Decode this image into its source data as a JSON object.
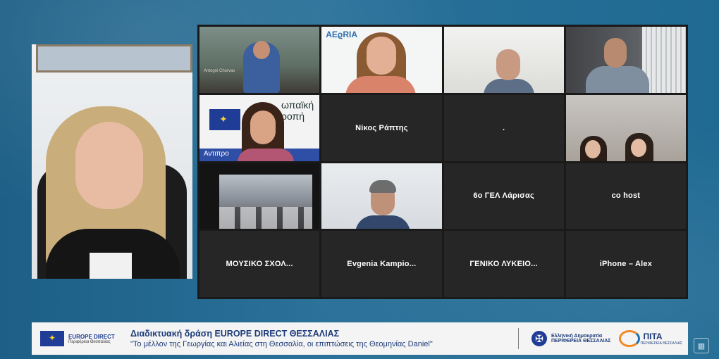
{
  "grid": {
    "tiles": [
      {
        "label": "",
        "video": "v1"
      },
      {
        "label": "",
        "video": "v2"
      },
      {
        "label": "",
        "video": "v3"
      },
      {
        "label": "",
        "video": "v4"
      },
      {
        "label": "",
        "video": "v5"
      },
      {
        "label": "Νίκος Ράπτης",
        "video": ""
      },
      {
        "label": ".",
        "video": ""
      },
      {
        "label": "",
        "video": "v6"
      },
      {
        "label": "",
        "video": "v7"
      },
      {
        "label": "",
        "video": "v8"
      },
      {
        "label": "6ο ΓΕΛ Λάρισας",
        "video": ""
      },
      {
        "label": "co host",
        "video": ""
      },
      {
        "label": "ΜΟΥΣΙΚΟ ΣΧΟΛ...",
        "video": ""
      },
      {
        "label": "Evgenia Kampio...",
        "video": ""
      },
      {
        "label": "ΓΕΝΙΚΟ ΛΥΚΕΙΟ...",
        "video": ""
      },
      {
        "label": "iPhone – Alex",
        "video": ""
      }
    ],
    "tile_overlays": {
      "v1_sign": "Antogni Chorvas",
      "v2_logo": "AEϱRIA",
      "v5_text": "ωπαϊκή\nροπή",
      "v5_banner": "Αντιπρο"
    }
  },
  "banner": {
    "europe_direct_title": "EUROPE DIRECT",
    "europe_direct_sub": "Περιφέρεια Θεσσαλίας",
    "event_title": "Διαδικτυακή δράση EUROPE DIRECT ΘΕΣΣΑΛΙΑΣ",
    "event_subtitle": "\"Το μέλλον της Γεωργίας και Αλιείας στη Θεσσαλία, οι επιπτώσεις της Θεομηνίας Daniel\"",
    "region_line1": "Ελληνική Δημοκρατία",
    "region_line2": "ΠΕΡΙΦΕΡΕΙΑ ΘΕΣΣΑΛΙΑΣ",
    "pita_name": "ΠΙΤΑ",
    "pita_sub": "ΠΕΡΙΦΕΡΕΙΑ ΘΕΣΣΑΛΙΑΣ"
  },
  "colors": {
    "background": "#2a7199",
    "tile": "#262626",
    "active_speaker": "#d6e36b",
    "banner_text": "#1d3b79"
  },
  "icons": {
    "corner": "layout-icon",
    "seal": "greek-seal-icon",
    "eu_flag": "eu-flag-icon"
  }
}
